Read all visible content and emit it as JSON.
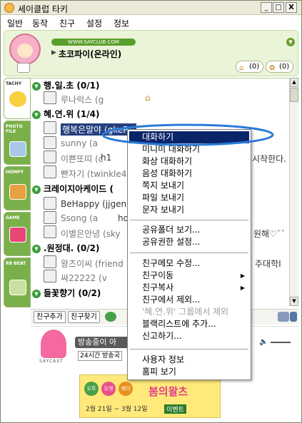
{
  "window": {
    "title": "세이클럽 타키",
    "controls": {
      "minimize": "_",
      "maximize": "□",
      "close": "X"
    }
  },
  "menubar": [
    "일반",
    "동작",
    "친구",
    "설정",
    "정보"
  ],
  "profile": {
    "banner": "WWW.SAYCLUB.COM",
    "nickname": "초코파이(온라인)",
    "home_count": "(0)",
    "ribbon_count": "(0)"
  },
  "side_tabs": [
    {
      "label": "TACHY",
      "icon": "tachy-icon"
    },
    {
      "label": "PHOTO FILE",
      "icon": "photo-icon"
    },
    {
      "label": "HOMPY",
      "icon": "home-icon"
    },
    {
      "label": "GAME",
      "icon": "game-icon"
    },
    {
      "label": "RB BEAT",
      "icon": "music-icon"
    }
  ],
  "groups": [
    {
      "name": "행.일.초 (0/1)"
    },
    {
      "name": "혜.연.위 (1/4)"
    },
    {
      "name": "크레이지아케이드 ("
    },
    {
      "name": ".원정대. (0/2)"
    },
    {
      "name": "들꽃향기 (0/2)"
    }
  ],
  "friends": [
    {
      "name": "루나럭스 (g"
    },
    {
      "name": "행복은말야 (gkeP..."
    },
    {
      "name": "sunny (a"
    },
    {
      "name": "이쁜또띠 (c"
    },
    {
      "name": "빤자기 (twinkle4"
    },
    {
      "name": "BeHappy (jjgeni"
    },
    {
      "name": "Ssong (a"
    },
    {
      "name": "이별은안녕 (sky"
    },
    {
      "name": "왕즈이씨 (friend"
    },
    {
      "name": "싸22222 (v"
    }
  ],
  "list_tails": [
    {
      "text": "h1"
    },
    {
      "text": "시작한다."
    },
    {
      "text": "ho"
    },
    {
      "text": "원해♡``"
    },
    {
      "text": "주대학I"
    }
  ],
  "context_menu": {
    "items": [
      {
        "label": "대화하기",
        "state": "highlighted"
      },
      {
        "label": "미니미 대화하기",
        "state": "normal"
      },
      {
        "label": "화상 대화하기",
        "state": "normal"
      },
      {
        "label": "음성 대화하기",
        "state": "normal"
      },
      {
        "label": "쪽지 보내기",
        "state": "normal"
      },
      {
        "label": "파일 보내기",
        "state": "normal"
      },
      {
        "label": "문자 보내기",
        "state": "normal"
      },
      {
        "label": "공유폴더 보기...",
        "state": "normal"
      },
      {
        "label": "공유권한 설정...",
        "state": "normal"
      },
      {
        "label": "친구메모 수정...",
        "state": "normal"
      },
      {
        "label": "친구이동",
        "state": "normal",
        "submenu": true
      },
      {
        "label": "친구복사",
        "state": "normal",
        "submenu": true
      },
      {
        "label": "친구에서 제외...",
        "state": "normal"
      },
      {
        "label": "'혜.연.위' 그룹에서 제외",
        "state": "disabled"
      },
      {
        "label": "블랙리스트에 추가...",
        "state": "normal"
      },
      {
        "label": "신고하기...",
        "state": "normal"
      },
      {
        "label": "사용자 정보",
        "state": "normal"
      },
      {
        "label": "홈피 보기",
        "state": "normal"
      }
    ]
  },
  "bottom_bar": {
    "add_friend": "친구추가",
    "find_friend": "친구찾기"
  },
  "saycast": {
    "label": "SAYCAST",
    "title": "방송중이 아",
    "button_24h": "24시간 방송국"
  },
  "ad": {
    "rings": [
      "오투",
      "듀엣",
      "메이"
    ],
    "headline": "봄의왈츠",
    "dates": "2월 21일 ~ 3월 12일",
    "event": "이벤트"
  },
  "colors": {
    "highlight": "#0a246a",
    "selected_friend": "#26407e",
    "group_icon": "#3a9b3a",
    "annotation_ellipse": "#2a7ad8"
  }
}
